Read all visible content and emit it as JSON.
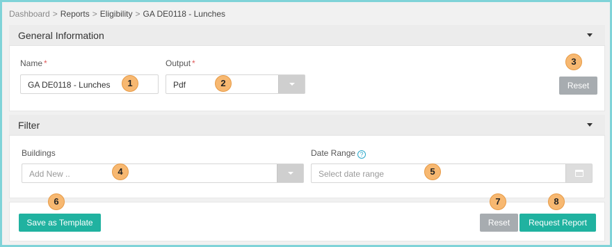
{
  "breadcrumb": {
    "items": [
      "Dashboard",
      "Reports",
      "Eligibility",
      "GA DE0118 - Lunches"
    ],
    "separator": ">"
  },
  "general": {
    "title": "General Information",
    "name_label": "Name",
    "name_value": "GA DE0118 - Lunches",
    "output_label": "Output",
    "output_value": "Pdf",
    "reset_label": "Reset",
    "required_mark": "*"
  },
  "filter": {
    "title": "Filter",
    "buildings_label": "Buildings",
    "buildings_placeholder": "Add New ..",
    "date_label": "Date Range",
    "date_placeholder": "Select date range",
    "help_glyph": "?"
  },
  "footer": {
    "save_template_label": "Save as Template",
    "reset_label": "Reset",
    "request_label": "Request Report"
  },
  "callouts": [
    "1",
    "2",
    "3",
    "4",
    "5",
    "6",
    "7",
    "8"
  ],
  "colors": {
    "accent": "#20b2a0",
    "gray_button": "#a7acb0",
    "callout": "#f7b871",
    "border_frame": "#7fd3d8",
    "required": "#e05a5a"
  },
  "icons": [
    "caret-down-icon",
    "calendar-icon",
    "help-icon"
  ]
}
